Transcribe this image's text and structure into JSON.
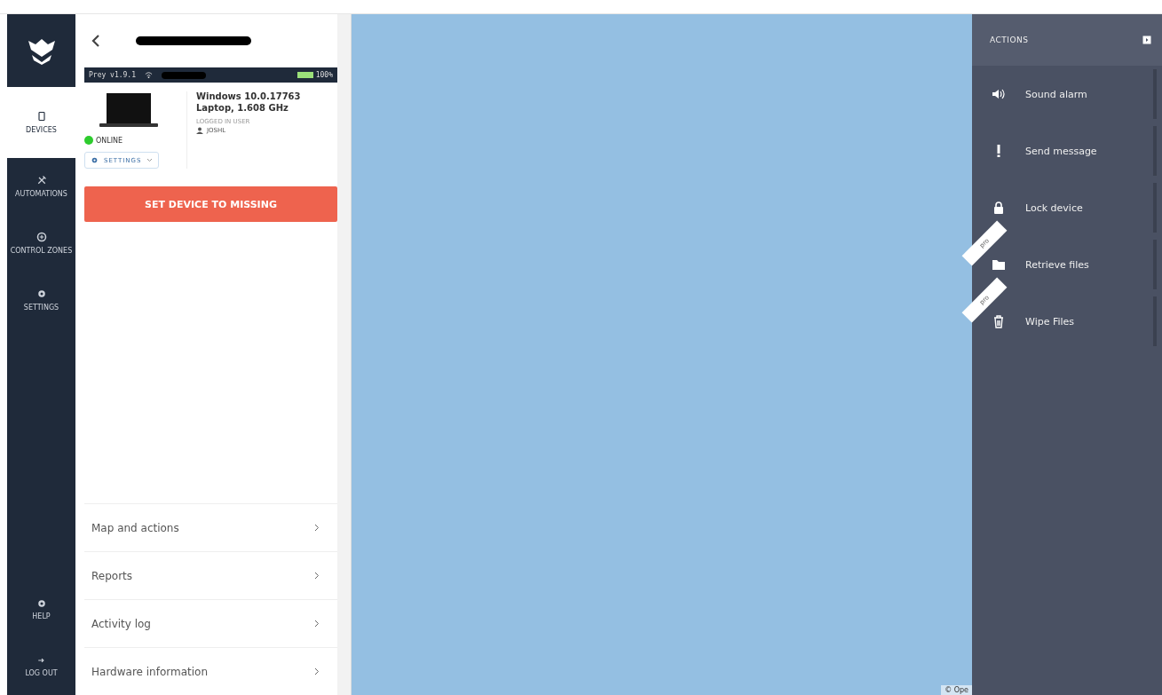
{
  "nav": {
    "items": [
      {
        "label": "DEVICES",
        "selected": true
      },
      {
        "label": "AUTOMATIONS",
        "selected": false
      },
      {
        "label": "CONTROL ZONES",
        "selected": false
      },
      {
        "label": "SETTINGS",
        "selected": false
      }
    ],
    "bottom_items": [
      {
        "label": "HELP"
      },
      {
        "label": "LOG OUT"
      }
    ]
  },
  "device": {
    "agent_version": "Prey v1.9.1",
    "battery": "100%",
    "os": "Windows 10.0.17763",
    "model": "Laptop, 1.608 GHz",
    "user_label": "LOGGED IN USER",
    "user": "JOSHL",
    "status": "ONLINE",
    "online": true,
    "settings_button": "SETTINGS",
    "missing_button": "SET DEVICE TO MISSING"
  },
  "menu": [
    {
      "label": "Map and actions"
    },
    {
      "label": "Reports"
    },
    {
      "label": "Activity log"
    },
    {
      "label": "Hardware information"
    }
  ],
  "map": {
    "attribution": "© Ope"
  },
  "actions": {
    "title": "ACTIONS",
    "items": [
      {
        "label": "Sound alarm"
      },
      {
        "label": "Send message"
      },
      {
        "label": "Lock device"
      },
      {
        "label": "Retrieve files",
        "badge": "pro"
      },
      {
        "label": "Wipe Files",
        "badge": "pro"
      }
    ]
  }
}
